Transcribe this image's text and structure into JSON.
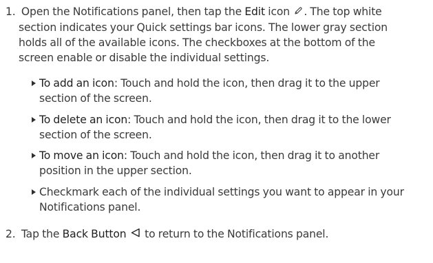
{
  "step1": {
    "number": "1.",
    "text_before_edit": "Open the Notifications panel, then tap the",
    "edit_label": "Edit",
    "text_after_edit": "icon",
    "text_end": ". The top white",
    "line2": "section indicates your Quick settings bar icons. The lower gray section",
    "line3": "holds all of the available icons. The checkboxes at the bottom of the",
    "line4": "screen enable or disable the individual settings.",
    "edit_icon": "pencil-icon"
  },
  "bullets": [
    {
      "label": "To add an icon",
      "line1_rest": ": Touch and hold the icon, then drag it to the upper",
      "line2": "section of the screen."
    },
    {
      "label": "To delete an icon",
      "line1_rest": ": Touch and hold the icon, then drag it to the lower",
      "line2": "section of the screen."
    },
    {
      "label": "To move an icon",
      "line1_rest": ": Touch and hold the icon, then drag it to another",
      "line2": "position in the upper section."
    },
    {
      "label": "",
      "line1_rest": "Checkmark each of the individual settings you want to appear in your",
      "line2": "Notifications panel."
    }
  ],
  "step2": {
    "number": "2.",
    "text_before": "Tap the",
    "back_label": "Back Button",
    "text_after": "to return to the Notifications panel.",
    "back_icon": "back-triangle-icon"
  }
}
